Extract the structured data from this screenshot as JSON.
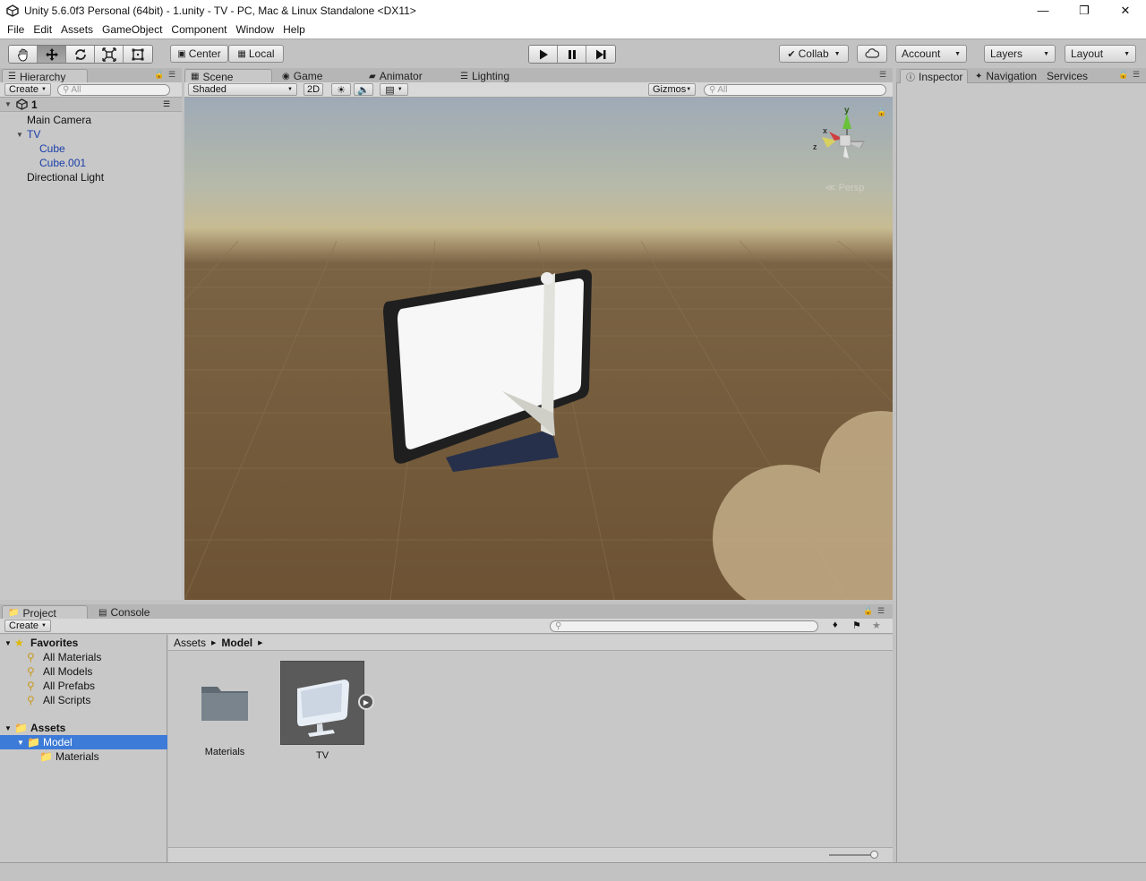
{
  "window": {
    "title": "Unity 5.6.0f3 Personal (64bit) - 1.unity - TV - PC, Mac & Linux Standalone <DX11>"
  },
  "menu": [
    "File",
    "Edit",
    "Assets",
    "GameObject",
    "Component",
    "Window",
    "Help"
  ],
  "toolbar": {
    "center_label": "Center",
    "local_label": "Local",
    "collab_label": "Collab",
    "account_label": "Account",
    "layers_label": "Layers",
    "layout_label": "Layout"
  },
  "hierarchy": {
    "tab": "Hierarchy",
    "create": "Create",
    "search_placeholder": "All",
    "scene_name": "1",
    "items": [
      {
        "label": "Main Camera"
      },
      {
        "label": "TV"
      },
      {
        "label": "Cube"
      },
      {
        "label": "Cube.001"
      },
      {
        "label": "Directional Light"
      }
    ]
  },
  "scene_tabs": [
    "Scene",
    "Game",
    "Animator",
    "Lighting"
  ],
  "scene_toolbar": {
    "shading": "Shaded",
    "mode_2d": "2D",
    "gizmos": "Gizmos",
    "search_placeholder": "All"
  },
  "gizmo": {
    "x": "x",
    "y": "y",
    "z": "z",
    "projection": "Persp"
  },
  "inspector_tabs": [
    "Inspector",
    "Navigation",
    "Services"
  ],
  "project": {
    "tabs": [
      "Project",
      "Console"
    ],
    "create": "Create",
    "favorites_label": "Favorites",
    "favorites": [
      "All Materials",
      "All Models",
      "All Prefabs",
      "All Scripts"
    ],
    "assets_label": "Assets",
    "tree": [
      "Model",
      "Materials"
    ],
    "breadcrumb": [
      "Assets",
      "Model"
    ],
    "items": [
      "Materials",
      "TV"
    ]
  },
  "colors": {
    "selection": "#3d7bd8",
    "link_blue": "#1a3ea8"
  }
}
